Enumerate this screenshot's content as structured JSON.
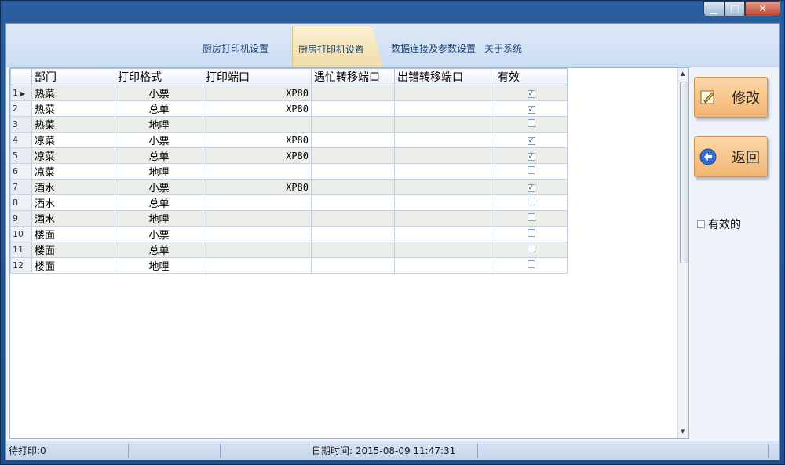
{
  "tabs": [
    {
      "label": "厨房打印机设置"
    },
    {
      "label": "厨房打印机设置",
      "active": true
    },
    {
      "label": "数据连接及参数设置"
    },
    {
      "label": "关于系统"
    }
  ],
  "grid": {
    "columns": [
      "部门",
      "打印格式",
      "打印端口",
      "遇忙转移端口",
      "出错转移端口",
      "有效"
    ],
    "rows": [
      {
        "n": "1",
        "dept": "热菜",
        "fmt": "小票",
        "port": "XP80",
        "busy": "",
        "err": "",
        "valid": true
      },
      {
        "n": "2",
        "dept": "热菜",
        "fmt": "总单",
        "port": "XP80",
        "busy": "",
        "err": "",
        "valid": true
      },
      {
        "n": "3",
        "dept": "热菜",
        "fmt": "地哩",
        "port": "",
        "busy": "",
        "err": "",
        "valid": false
      },
      {
        "n": "4",
        "dept": "凉菜",
        "fmt": "小票",
        "port": "XP80",
        "busy": "",
        "err": "",
        "valid": true
      },
      {
        "n": "5",
        "dept": "凉菜",
        "fmt": "总单",
        "port": "XP80",
        "busy": "",
        "err": "",
        "valid": true
      },
      {
        "n": "6",
        "dept": "凉菜",
        "fmt": "地哩",
        "port": "",
        "busy": "",
        "err": "",
        "valid": false
      },
      {
        "n": "7",
        "dept": "酒水",
        "fmt": "小票",
        "port": "XP80",
        "busy": "",
        "err": "",
        "valid": true
      },
      {
        "n": "8",
        "dept": "酒水",
        "fmt": "总单",
        "port": "",
        "busy": "",
        "err": "",
        "valid": false
      },
      {
        "n": "9",
        "dept": "酒水",
        "fmt": "地哩",
        "port": "",
        "busy": "",
        "err": "",
        "valid": false
      },
      {
        "n": "10",
        "dept": "楼面",
        "fmt": "小票",
        "port": "",
        "busy": "",
        "err": "",
        "valid": false
      },
      {
        "n": "11",
        "dept": "楼面",
        "fmt": "总单",
        "port": "",
        "busy": "",
        "err": "",
        "valid": false
      },
      {
        "n": "12",
        "dept": "楼面",
        "fmt": "地哩",
        "port": "",
        "busy": "",
        "err": "",
        "valid": false
      }
    ]
  },
  "side": {
    "edit_label": "修改",
    "back_label": "返回",
    "valid_only_label": "有效的"
  },
  "status": {
    "pending": "待打印:0",
    "datetime": "日期时间: 2015-08-09 11:47:31"
  },
  "colors": {
    "accent": "#f3b673",
    "title_bar": "#2b5e9e"
  }
}
